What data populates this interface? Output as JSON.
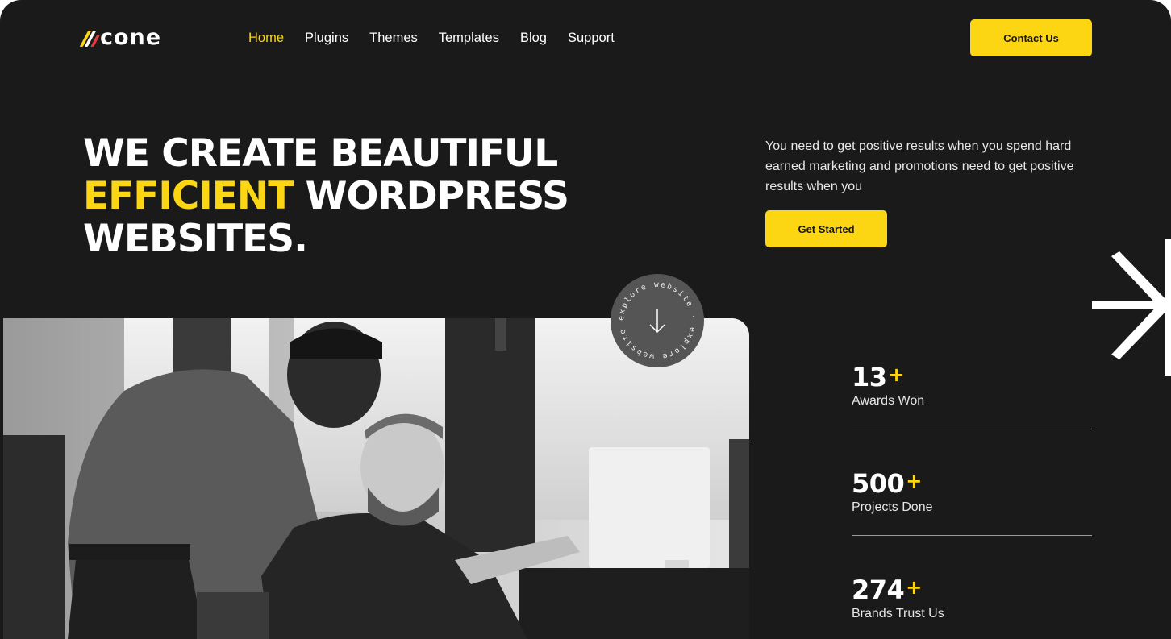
{
  "brand": {
    "name": "cone",
    "accent_color": "#fcd612",
    "background_color": "#1a1a1a",
    "logo_colors": [
      "#fcd612",
      "#ffffff",
      "#e23b3b"
    ]
  },
  "nav": {
    "items": [
      {
        "label": "Home",
        "active": true
      },
      {
        "label": "Plugins",
        "active": false
      },
      {
        "label": "Themes",
        "active": false
      },
      {
        "label": "Templates",
        "active": false
      },
      {
        "label": "Blog",
        "active": false
      },
      {
        "label": "Support",
        "active": false
      }
    ],
    "contact_label": "Contact Us"
  },
  "hero": {
    "line1": "WE CREATE BEAUTIFUL",
    "line2_highlight": "EFFICIENT",
    "line2_rest": " WORDPRESS",
    "line3": "WEBSITES.",
    "intro": "You need to get positive results when you spend hard earned marketing and promotions need to get positive results when you",
    "cta_label": "Get Started"
  },
  "explore_badge": {
    "text": "explore website · explore website · ",
    "icon": "arrow-down-icon"
  },
  "stats": [
    {
      "value": "13",
      "suffix": "+",
      "label": "Awards Won"
    },
    {
      "value": "500",
      "suffix": "+",
      "label": "Projects Done"
    },
    {
      "value": "274",
      "suffix": "+",
      "label": "Brands Trust Us"
    }
  ],
  "decor_icon": "asterisk-arrow-icon"
}
